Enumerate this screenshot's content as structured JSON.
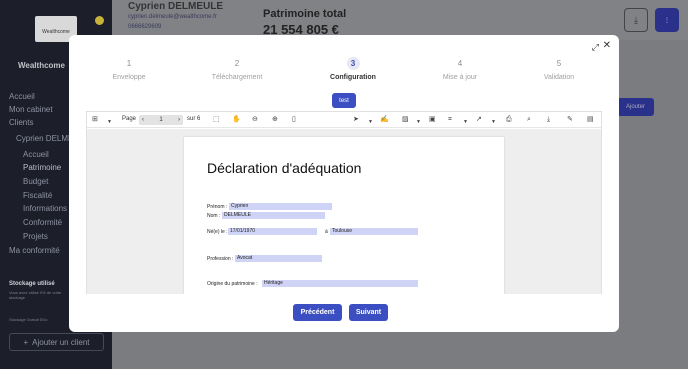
{
  "background": {
    "logo_text": "Wealthcome",
    "brand": "Wealthcome",
    "nav": {
      "accueil": "Accueil",
      "mon_cabinet": "Mon cabinet",
      "clients": "Clients",
      "client_current": "Cyprien DELMEULE",
      "sub_accueil": "Accueil",
      "sub_patrimoine": "Patrimoine",
      "sub_budget": "Budget",
      "sub_fiscalite": "Fiscalité",
      "sub_informations": "Informations",
      "sub_conformite": "Conformité",
      "sub_projets": "Projets",
      "ma_conformite": "Ma conformité"
    },
    "storage": {
      "title": "Stockage utilisé",
      "subtitle": "Vous avez utilisé 0% de votre stockage",
      "footer": "Stockage Gratuit 5Go"
    },
    "add_client": "Ajouter un client",
    "client": {
      "name": "Cyprien DELMEULE",
      "email": "cyprien.delmeule@wealthcome.fr",
      "phone": "0666629609"
    },
    "patrimoine": {
      "label": "Patrimoine total",
      "value": "21 554 805 €"
    },
    "ajouter": "Ajouter"
  },
  "modal": {
    "steps": [
      {
        "num": "1",
        "label": "Enveloppe"
      },
      {
        "num": "2",
        "label": "Téléchargement"
      },
      {
        "num": "3",
        "label": "Configuration"
      },
      {
        "num": "4",
        "label": "Mise à jour"
      },
      {
        "num": "5",
        "label": "Validation"
      }
    ],
    "active_step": 3,
    "tag": "test",
    "viewer": {
      "page_label": "Page",
      "page_value": "1",
      "of_label": "sur 6"
    },
    "document": {
      "title": "Déclaration d'adéquation",
      "prenom_label": "Prénom :",
      "prenom_value": "Cyprien",
      "nom_label": "Nom :",
      "nom_value": "DELMEULE",
      "naissance_label": "Né(e) le :",
      "naissance_value": "17/01/1970",
      "lieu_label": "à",
      "lieu_value": "Toulouse",
      "profession_label": "Profession :",
      "profession_value": "Avocat",
      "origine_label": "Origine du patrimoine :",
      "origine_value": "Héritage"
    },
    "buttons": {
      "previous": "Précédent",
      "next": "Suivant"
    }
  },
  "colors": {
    "accent": "#3b4fc2",
    "field_highlight": "#cfd3f5",
    "sidebar": "#1c1e29"
  }
}
